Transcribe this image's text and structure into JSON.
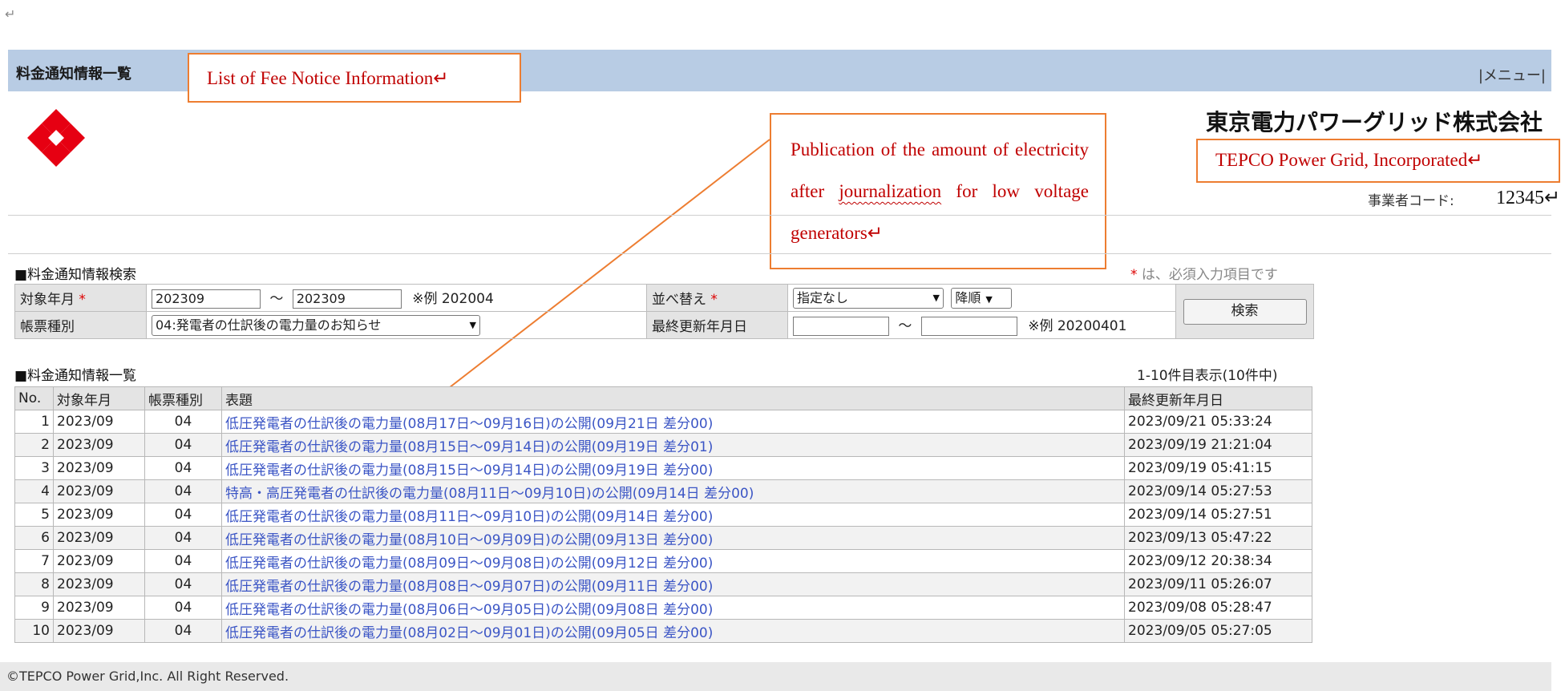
{
  "colors": {
    "header_band": "#b8cce4",
    "annotation_border": "#ed7d31",
    "annotation_text": "#c00000",
    "logo_red": "#e60012",
    "link": "#3b55c5",
    "required_mark": "#dd0000"
  },
  "return_mark": "↵",
  "header": {
    "title": "料金通知情報一覧",
    "menu": "|メニュー|"
  },
  "annotations": {
    "title": "List of Fee Notice Information↵",
    "publication_before": "Publication of the amount of electricity after ",
    "publication_squiggle": "journalization",
    "publication_after": " for low voltage generators↵",
    "company": "TEPCO Power Grid, Incorporated↵"
  },
  "company": {
    "name_jp": "東京電力パワーグリッド株式会社",
    "code_label": "事業者コード:",
    "code_value": "12345↵",
    "logo_icon": "tepco-diamond-logo-icon"
  },
  "search": {
    "section_title": "■料金通知情報検索",
    "required_mark": "*",
    "required_note": "は、必須入力項目です",
    "target_month_label": "対象年月",
    "from_month": "202309",
    "tilde": "～",
    "to_month": "202309",
    "month_example": "※例 202004",
    "sort_label": "並べ替え",
    "sort_value": "指定なし",
    "order_value": "降順",
    "form_type_label": "帳票種別",
    "form_type_value": "04:発電者の仕訳後の電力量のお知らせ",
    "last_updated_label": "最終更新年月日",
    "date_from": "",
    "date_to": "",
    "date_example": "※例 20200401",
    "search_button": "検索"
  },
  "list": {
    "section_title": "■料金通知情報一覧",
    "count_text": "1-10件目表示(10件中)",
    "headers": [
      "No.",
      "対象年月",
      "帳票種別",
      "表題",
      "最終更新年月日"
    ],
    "rows": [
      {
        "no": "1",
        "month": "2023/09",
        "type": "04",
        "title": "低圧発電者の仕訳後の電力量(08月17日～09月16日)の公開(09月21日 差分00)",
        "updated": "2023/09/21 05:33:24"
      },
      {
        "no": "2",
        "month": "2023/09",
        "type": "04",
        "title": "低圧発電者の仕訳後の電力量(08月15日～09月14日)の公開(09月19日 差分01)",
        "updated": "2023/09/19 21:21:04"
      },
      {
        "no": "3",
        "month": "2023/09",
        "type": "04",
        "title": "低圧発電者の仕訳後の電力量(08月15日～09月14日)の公開(09月19日 差分00)",
        "updated": "2023/09/19 05:41:15"
      },
      {
        "no": "4",
        "month": "2023/09",
        "type": "04",
        "title": "特高・高圧発電者の仕訳後の電力量(08月11日～09月10日)の公開(09月14日 差分00)",
        "updated": "2023/09/14 05:27:53"
      },
      {
        "no": "5",
        "month": "2023/09",
        "type": "04",
        "title": "低圧発電者の仕訳後の電力量(08月11日～09月10日)の公開(09月14日 差分00)",
        "updated": "2023/09/14 05:27:51"
      },
      {
        "no": "6",
        "month": "2023/09",
        "type": "04",
        "title": "低圧発電者の仕訳後の電力量(08月10日～09月09日)の公開(09月13日 差分00)",
        "updated": "2023/09/13 05:47:22"
      },
      {
        "no": "7",
        "month": "2023/09",
        "type": "04",
        "title": "低圧発電者の仕訳後の電力量(08月09日～09月08日)の公開(09月12日 差分00)",
        "updated": "2023/09/12 20:38:34"
      },
      {
        "no": "8",
        "month": "2023/09",
        "type": "04",
        "title": "低圧発電者の仕訳後の電力量(08月08日～09月07日)の公開(09月11日 差分00)",
        "updated": "2023/09/11 05:26:07"
      },
      {
        "no": "9",
        "month": "2023/09",
        "type": "04",
        "title": "低圧発電者の仕訳後の電力量(08月06日～09月05日)の公開(09月08日 差分00)",
        "updated": "2023/09/08 05:28:47"
      },
      {
        "no": "10",
        "month": "2023/09",
        "type": "04",
        "title": "低圧発電者の仕訳後の電力量(08月02日～09月01日)の公開(09月05日 差分00)",
        "updated": "2023/09/05 05:27:05"
      }
    ]
  },
  "footer": {
    "copyright": "©TEPCO Power Grid,Inc. All Right Reserved."
  }
}
